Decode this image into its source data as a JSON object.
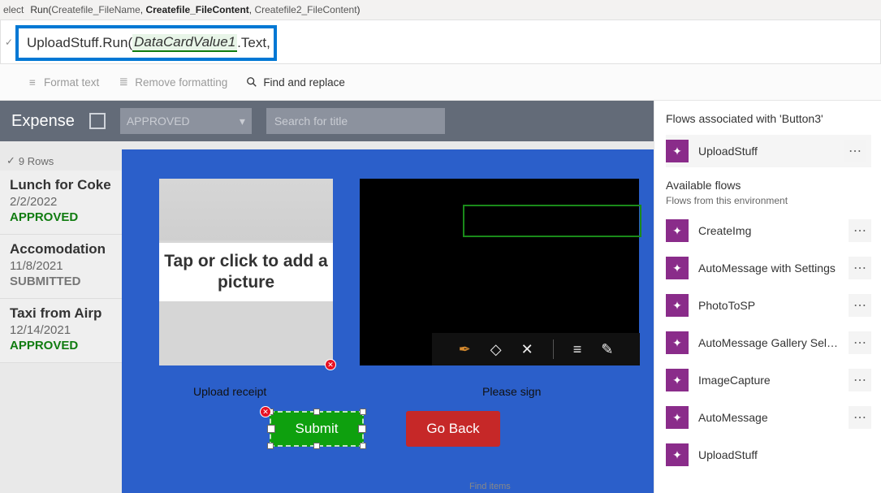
{
  "topbar": {
    "selectLabel": "elect",
    "runSig": {
      "fn": "Run",
      "p1": "Createfile_FileName",
      "p2": "Createfile_FileContent",
      "p3": "Createfile2_FileContent"
    }
  },
  "formula": {
    "obj": "UploadStuff",
    "method": ".Run(",
    "arg": "DataCardValue1",
    "tail": ".Text, "
  },
  "toolbar": {
    "format": "Format text",
    "remove": "Remove formatting",
    "find": "Find and replace"
  },
  "expense": {
    "title": "Expense",
    "dropdown": "APPROVED",
    "searchPlaceholder": "Search for title",
    "rows": "9 Rows"
  },
  "list": [
    {
      "title": "Lunch for Coke",
      "date": "2/2/2022",
      "status": "APPROVED",
      "cls": "approved"
    },
    {
      "title": "Accomodation",
      "date": "11/8/2021",
      "status": "SUBMITTED",
      "cls": "submitted"
    },
    {
      "title": "Taxi from Airp",
      "date": "12/14/2021",
      "status": "APPROVED",
      "cls": "approved"
    }
  ],
  "panel": {
    "uploadPrompt": "Tap or click to add a picture",
    "uploadLabel": "Upload receipt",
    "signLabel": "Please sign",
    "submit": "Submit",
    "goback": "Go Back",
    "findItems": "Find items"
  },
  "flows": {
    "header": "Flows associated with 'Button3'",
    "associated": [
      {
        "name": "UploadStuff"
      }
    ],
    "availableHeader": "Available flows",
    "envLabel": "Flows from this environment",
    "available": [
      {
        "name": "CreateImg"
      },
      {
        "name": "AutoMessage with Settings"
      },
      {
        "name": "PhotoToSP"
      },
      {
        "name": "AutoMessage Gallery Select..."
      },
      {
        "name": "ImageCapture"
      },
      {
        "name": "AutoMessage"
      },
      {
        "name": "UploadStuff"
      }
    ]
  }
}
